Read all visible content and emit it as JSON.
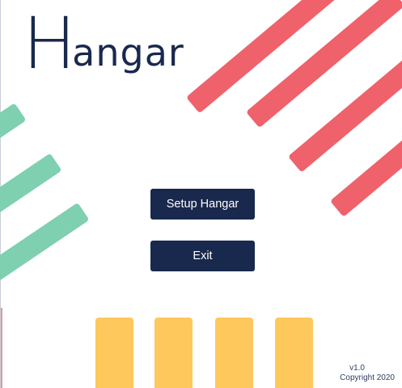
{
  "app": {
    "logo_initial": "H",
    "logo_rest": "angar"
  },
  "menu": {
    "setup_label": "Setup Hangar",
    "exit_label": "Exit"
  },
  "footer": {
    "version": "v1.0",
    "copyright": "Copyright 2020"
  },
  "colors": {
    "navy": "#19294d",
    "red": "#ef616b",
    "green": "#7fd0b0",
    "yellow": "#ffc85c"
  }
}
